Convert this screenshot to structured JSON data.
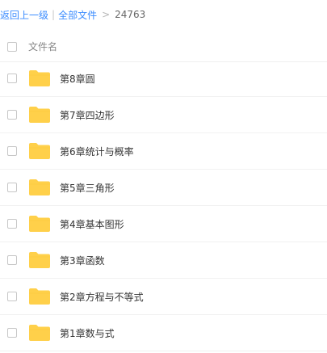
{
  "breadcrumb": {
    "back": "返回上一级",
    "separator": "|",
    "all_files": "全部文件",
    "chevron": ">",
    "current": "24763"
  },
  "header": {
    "name_column": "文件名"
  },
  "folders": [
    "第8章圆",
    "第7章四边形",
    "第6章统计与概率",
    "第5章三角形",
    "第4章基本图形",
    "第3章函数",
    "第2章方程与不等式",
    "第1章数与式"
  ],
  "colors": {
    "link": "#3b8cff",
    "folder": "#ffd04a"
  },
  "icons": {
    "folder": "folder-icon"
  }
}
